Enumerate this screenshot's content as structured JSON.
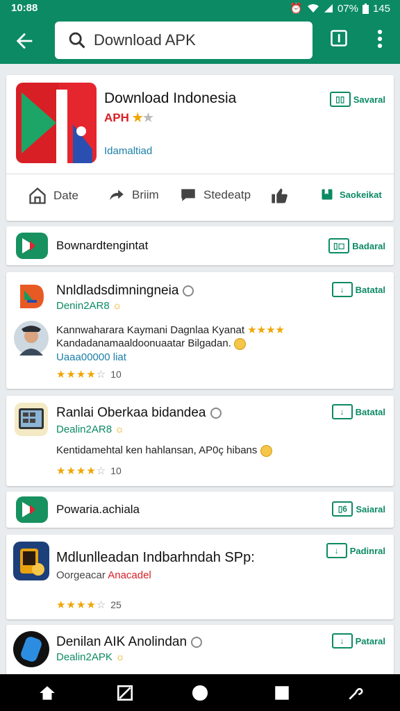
{
  "status_bar": {
    "time": "10:88",
    "battery": "07%",
    "extra": "145"
  },
  "toolbar": {
    "search_text": "Download APK"
  },
  "featured": {
    "title": "Download Indonesia",
    "subtitle": "APH",
    "link": "Idamaltiad",
    "button_label": "Savaral",
    "actions": [
      {
        "label": "Date"
      },
      {
        "label": "Briim"
      },
      {
        "label": "Stedeatp"
      },
      {
        "label": ""
      },
      {
        "label": "Saokeikat"
      }
    ]
  },
  "cards": [
    {
      "title": "Bownardtengintat",
      "button": "Badaral"
    },
    {
      "title": "Nnldladsdimningneia",
      "sub": "Denin2AR8",
      "button": "Batatal",
      "review1": "Kannwaharara Kaymani Dagnlaa Kyanat",
      "review2": "Kandadanamaaldoonuaatar Bilgadan.",
      "review3": "Uaaa00000 liat",
      "count": "10"
    },
    {
      "title": "Ranlai Oberkaa bidandea",
      "sub": "Dealin2AR8",
      "button": "Batatal",
      "review1": "Kentidamehtal ken hahlansan, AP0ç hibans",
      "count": "10"
    },
    {
      "title": "Powaria.achiala",
      "button": "Saiaral"
    },
    {
      "title": "Mdlunlleadan Indbarhndah SPp:",
      "sub": "Oorgeacar",
      "sub2": "Anacadel",
      "button": "Padinral",
      "count": "25"
    },
    {
      "title": "Denilan AIK Anolindan",
      "sub": "Dealin2APK",
      "button": "Pataral"
    }
  ]
}
